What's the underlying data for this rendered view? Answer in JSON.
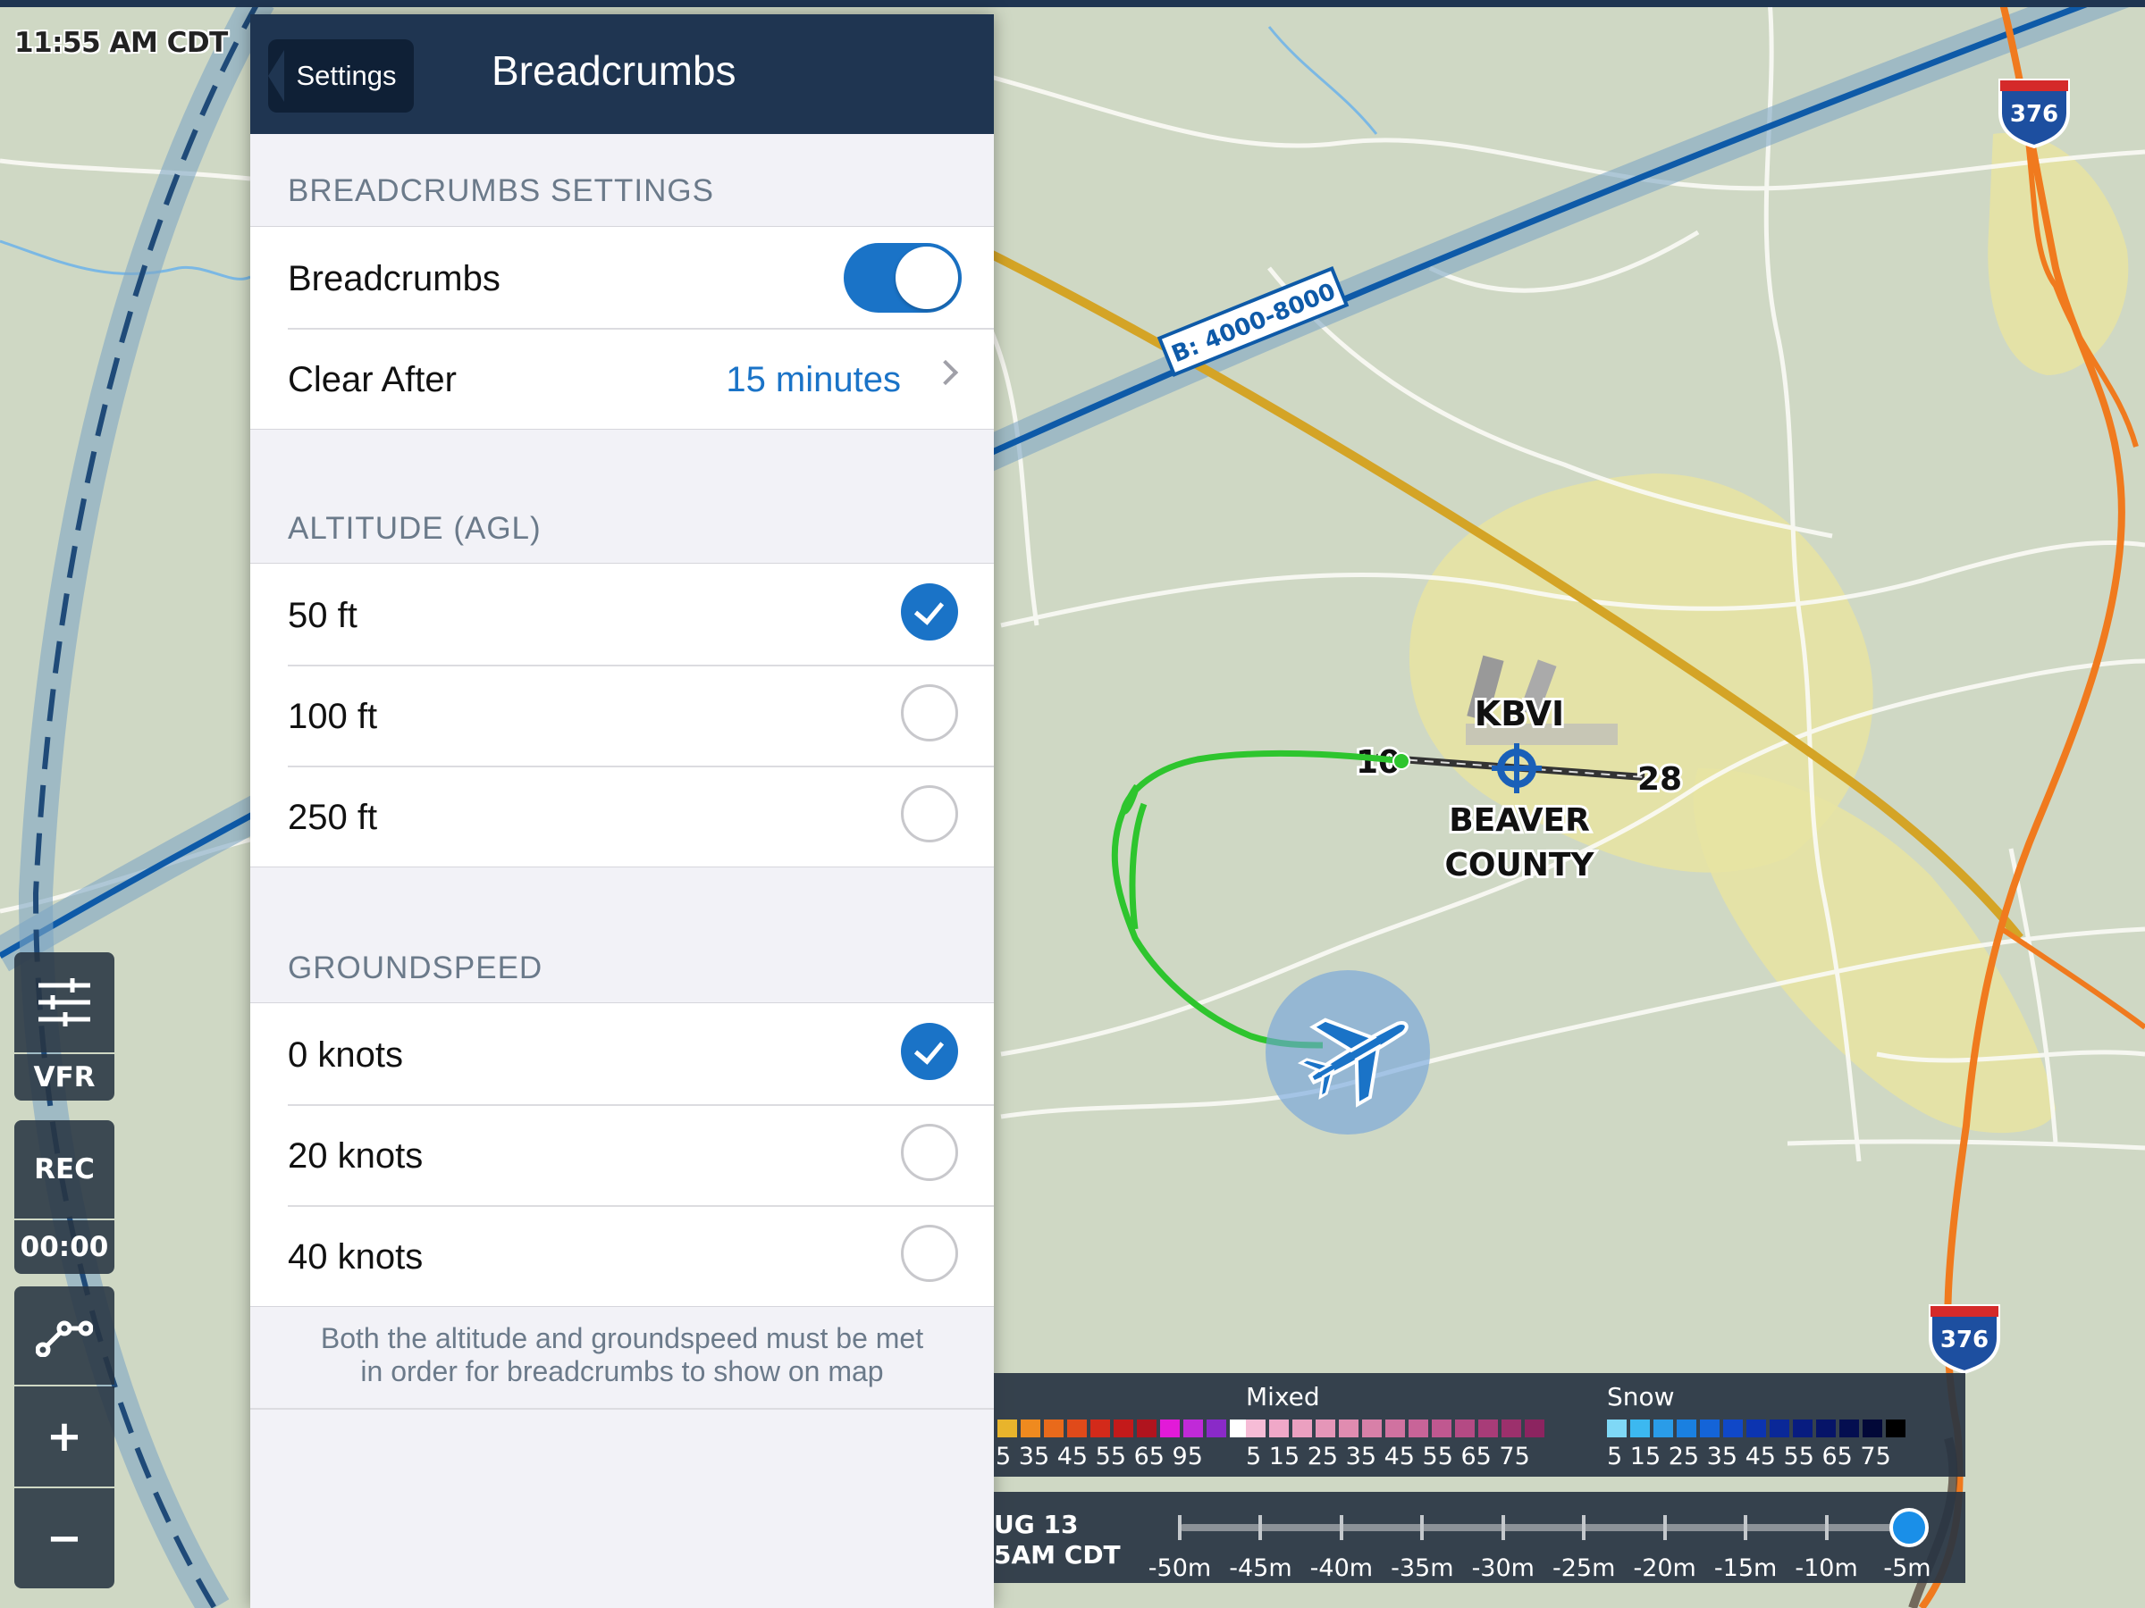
{
  "status_bar": {
    "time": "11:55 AM CDT"
  },
  "map": {
    "airspace_label": "B: 4000-8000",
    "airport": {
      "id": "KBVI",
      "name_line1": "BEAVER",
      "name_line2": "COUNTY",
      "runway_a": "10",
      "runway_b": "28"
    },
    "highway_shield": "376",
    "colors": {
      "airspace": "#0e5aa8",
      "breadcrumb_track": "#2ec52e",
      "highway": "#f07a1e",
      "ownship": "#1a73c7",
      "urban": "#e7e4a2"
    }
  },
  "toolbar": {
    "layers_icon": "sliders-icon",
    "vfr_label": "VFR",
    "rec_label": "REC",
    "rec_time": "00:00",
    "route_icon": "route-icon",
    "zoom_in_label": "+",
    "zoom_out_label": "−"
  },
  "panel": {
    "back_label": "Settings",
    "title": "Breadcrumbs",
    "settings_header": "BREADCRUMBS SETTINGS",
    "breadcrumbs_label": "Breadcrumbs",
    "breadcrumbs_enabled": true,
    "clear_after_label": "Clear After",
    "clear_after_value": "15 minutes",
    "altitude_header": "ALTITUDE (AGL)",
    "altitude_options": [
      {
        "label": "50 ft",
        "checked": true
      },
      {
        "label": "100 ft",
        "checked": false
      },
      {
        "label": "250 ft",
        "checked": false
      }
    ],
    "groundspeed_header": "GROUNDSPEED",
    "groundspeed_options": [
      {
        "label": "0 knots",
        "checked": true
      },
      {
        "label": "20 knots",
        "checked": false
      },
      {
        "label": "40 knots",
        "checked": false
      }
    ],
    "footnote_line1": "Both the altitude and groundspeed must be met",
    "footnote_line2": "in order for breadcrumbs to show on map"
  },
  "radar_legend": {
    "rain_nums": "5 35 45 55 65 95",
    "mixed_label": "Mixed",
    "mixed_nums": "5  15  25  35  45  55  65 75",
    "snow_label": "Snow",
    "snow_nums": "5  15  25  35  45  55  65 75",
    "rain_colors": [
      "#e8b42c",
      "#ef8a1f",
      "#e96a1b",
      "#e04a1a",
      "#d32a1a",
      "#c41a1a",
      "#b0141e",
      "#e21ad8",
      "#c02ad8",
      "#8a2ac8",
      "#ffffff"
    ],
    "mixed_colors": [
      "#f6bcd6",
      "#f0a8c8",
      "#eba0c0",
      "#e596b8",
      "#e08cb0",
      "#d880a8",
      "#d072a0",
      "#c86498",
      "#c05890",
      "#b44a84",
      "#a83c78",
      "#9c306c",
      "#8c2460"
    ],
    "snow_colors": [
      "#7fd8f6",
      "#3cb8f0",
      "#2a9ce8",
      "#1a80e0",
      "#1464d8",
      "#1048c8",
      "#0c34b0",
      "#0a2898",
      "#081c80",
      "#061468",
      "#040e50",
      "#020838",
      "#000000"
    ]
  },
  "timeline": {
    "date_line1": "UG 13",
    "date_line2": "5AM CDT",
    "ticks": [
      "-50m",
      "-45m",
      "-40m",
      "-35m",
      "-30m",
      "-25m",
      "-20m",
      "-15m",
      "-10m",
      "-5m"
    ],
    "selected": "-5m"
  }
}
